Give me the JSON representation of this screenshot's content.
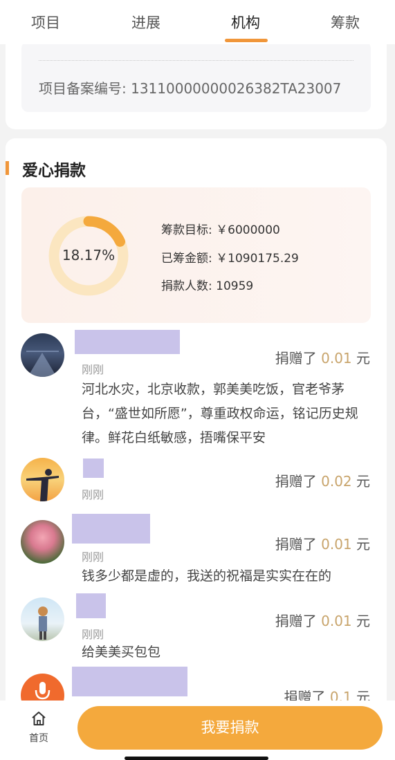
{
  "tabs": [
    {
      "label": "项目"
    },
    {
      "label": "进展"
    },
    {
      "label": "机构"
    },
    {
      "label": "筹款"
    }
  ],
  "active_tab": "机构",
  "record": {
    "text": "项目备案编号: 13110000000026382TA23007"
  },
  "donation_section": {
    "title": "爱心捐款",
    "progress_percent_text": "18.17%",
    "progress_fraction": 0.1817,
    "goal_text": "筹款目标: ￥6000000",
    "raised_text": "已筹金额: ￥1090175.29",
    "donors_text": "捐款人数: 10959"
  },
  "donations": [
    {
      "time": "刚刚",
      "prefix": "捐赠了",
      "amount": "0.01",
      "unit": "元",
      "message": "河北水灾，北京收款，郭美美吃饭，官老爷茅台，“盛世如所愿”，尊重政权命运，铭记历史规律。鲜花白纸敏感，捂嘴保平安"
    },
    {
      "time": "刚刚",
      "prefix": "捐赠了",
      "amount": "0.02",
      "unit": "元",
      "message": ""
    },
    {
      "time": "刚刚",
      "prefix": "捐赠了",
      "amount": "0.01",
      "unit": "元",
      "message": "钱多少都是虚的，我送的祝福是实实在在的"
    },
    {
      "time": "刚刚",
      "prefix": "捐赠了",
      "amount": "0.01",
      "unit": "元",
      "message": "给美美买包包"
    },
    {
      "time": "",
      "prefix": "捐赠了",
      "amount": "0.1",
      "unit": "元",
      "message": ""
    }
  ],
  "bottom_bar": {
    "home_label": "首页",
    "donate_button": "我要捐款"
  },
  "colors": {
    "accent": "#f0963a",
    "button": "#f4a93d",
    "amount": "#c8a46b",
    "redacted_name": "#c9c3ea"
  },
  "icons": [
    "home-icon",
    "microphone-icon"
  ]
}
